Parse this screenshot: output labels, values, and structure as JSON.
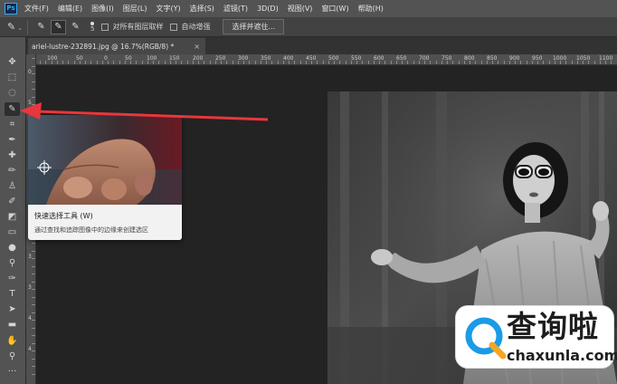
{
  "app": {
    "logo_text": "Ps"
  },
  "menu": [
    "文件(F)",
    "编辑(E)",
    "图像(I)",
    "图层(L)",
    "文字(Y)",
    "选择(S)",
    "滤镜(T)",
    "3D(D)",
    "视图(V)",
    "窗口(W)",
    "帮助(H)"
  ],
  "options_bar": {
    "brush_size": "5",
    "sample_all_layers_label": "对所有图层取样",
    "auto_enhance_label": "自动增强",
    "select_and_mask_label": "选择并遮住..."
  },
  "document_tab": {
    "title": "ariel-lustre-232891.jpg @ 16.7%(RGB/8) *",
    "close": "×"
  },
  "ruler_labels": [
    "100",
    "50",
    "0",
    "50",
    "100",
    "150",
    "200",
    "250",
    "300",
    "350",
    "400",
    "450",
    "500",
    "550",
    "600",
    "650",
    "700",
    "750",
    "800",
    "850",
    "900",
    "950",
    "1000",
    "1050",
    "1100"
  ],
  "vruler_labels": [
    "0",
    "5",
    "1",
    "1",
    "2",
    "2",
    "3",
    "3",
    "4",
    "4"
  ],
  "tooltip": {
    "title": "快速选择工具 (W)",
    "description": "通过查找和追踪图像中的边缘来创建选区"
  },
  "watermark": {
    "brand_cn": "查询啦",
    "brand_en": "chaxunla.com"
  },
  "colors": {
    "arrow": "#e8373c",
    "watermark_ring": "#1a9be8",
    "watermark_accent": "#f5a623"
  }
}
